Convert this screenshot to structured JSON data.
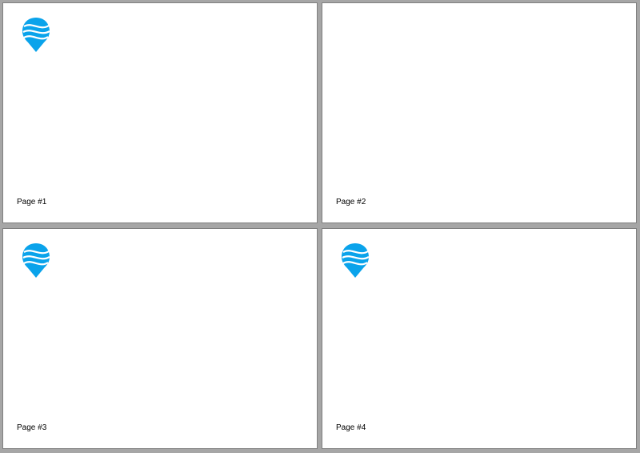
{
  "document": {
    "pages": [
      {
        "label": "Page #1",
        "has_logo": true
      },
      {
        "label": "Page #2",
        "has_logo": false
      },
      {
        "label": "Page #3",
        "has_logo": true
      },
      {
        "label": "Page #4",
        "has_logo": true
      }
    ]
  },
  "logo": {
    "icon": "location-pin-logo-icon",
    "color": "#0aa3eb",
    "stripe_color": "#ffffff"
  },
  "background": "#a6a6a6"
}
